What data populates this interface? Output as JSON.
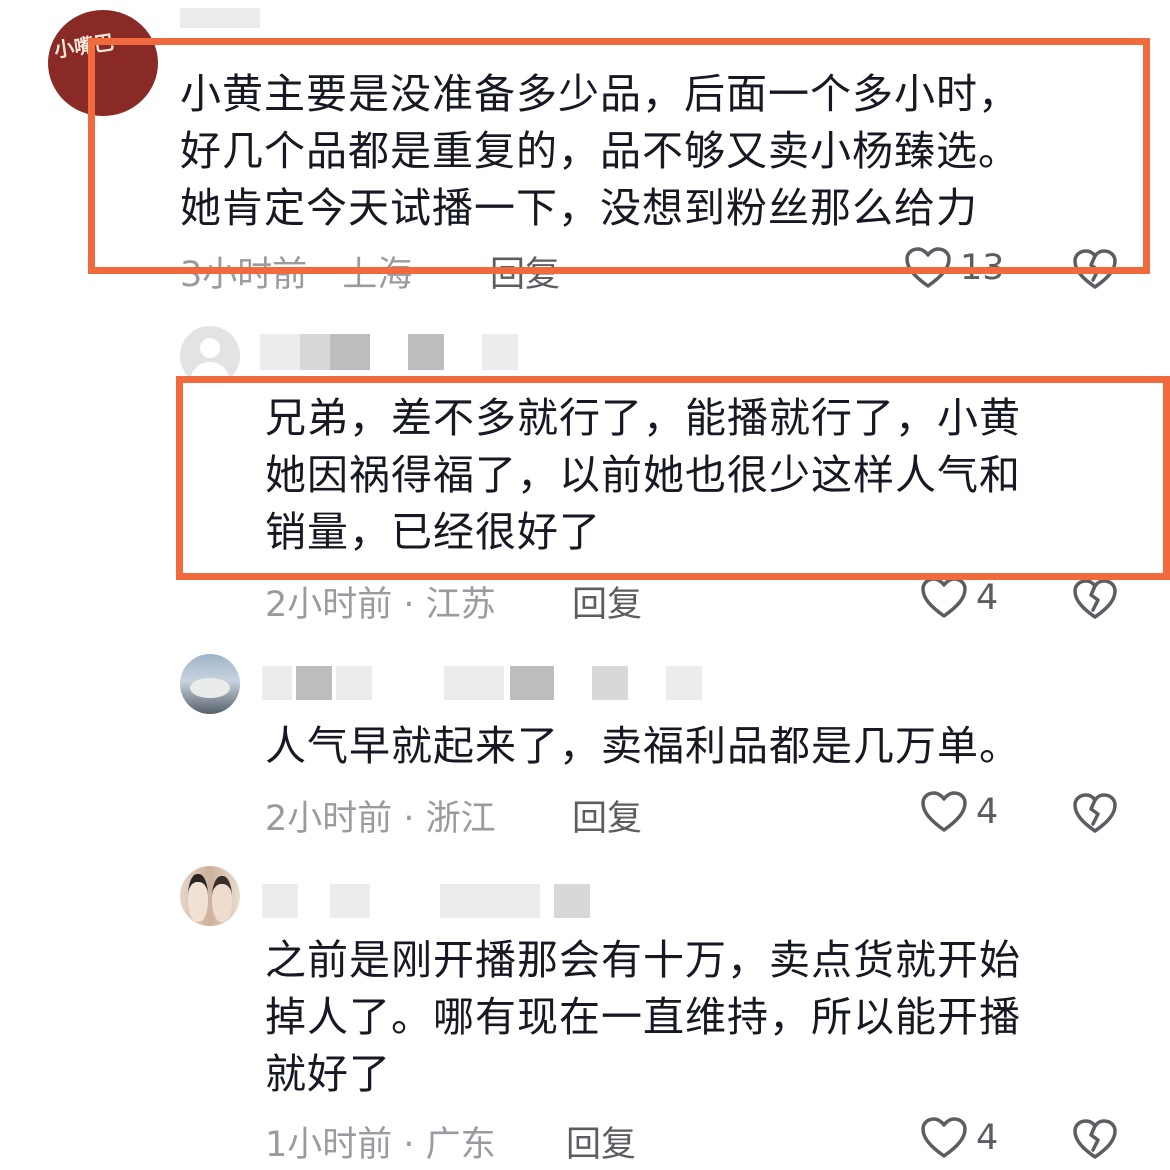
{
  "comments": [
    {
      "text_lines": [
        "小黄主要是没准备多少品，后面一个多小时，",
        "好几个品都是重复的，品不够又卖小杨臻选。",
        "她肯定今天试播一下，没想到粉丝那么给力"
      ],
      "time": "3小时前",
      "location": "上海",
      "reply": "回复",
      "likes": "13",
      "avatar_text": "小嘴巴"
    },
    {
      "text_lines": [
        "兄弟，差不多就行了，能播就行了，小黄",
        "她因祸得福了，以前她也很少这样人气和",
        "销量，已经很好了"
      ],
      "time": "2小时前",
      "location": "江苏",
      "reply": "回复",
      "likes": "4"
    },
    {
      "text_lines": [
        "人气早就起来了，卖福利品都是几万单。"
      ],
      "time": "2小时前",
      "location": "浙江",
      "reply": "回复",
      "likes": "4"
    },
    {
      "text_lines": [
        "之前是刚开播那会有十万，卖点货就开始",
        "掉人了。哪有现在一直维持，所以能开播",
        "就好了"
      ],
      "time": "1小时前",
      "location": "广东",
      "reply": "回复",
      "likes": "4"
    }
  ],
  "icons": {
    "like": "heart-outline-icon",
    "dislike": "broken-heart-icon"
  },
  "colors": {
    "highlight": "#f06a3e",
    "meta_text": "#9a9ba1"
  }
}
